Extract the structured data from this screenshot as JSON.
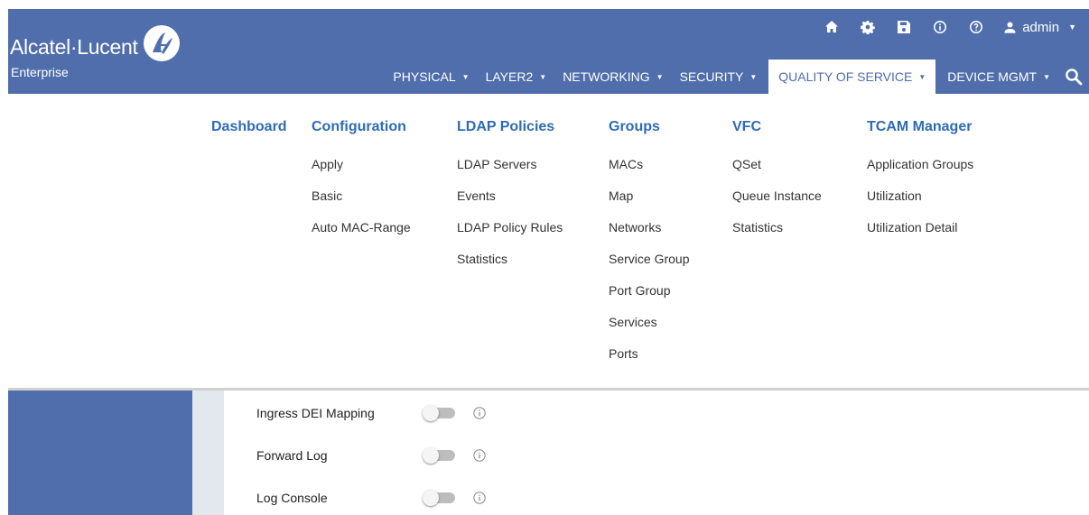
{
  "brand": {
    "name": "Alcatel·Lucent",
    "sub": "Enterprise",
    "colors": {
      "header": "#4f6eab",
      "link": "#2d6cb5",
      "toggle_off": "#bdbdbd",
      "gutter": "#e3e8ef"
    }
  },
  "topbar": {
    "icons": [
      "home-icon",
      "gear-icon",
      "save-icon",
      "info-icon",
      "help-icon"
    ],
    "user": "admin"
  },
  "nav": {
    "items": [
      {
        "label": "PHYSICAL"
      },
      {
        "label": "LAYER2"
      },
      {
        "label": "NETWORKING"
      },
      {
        "label": "SECURITY"
      },
      {
        "label": "QUALITY OF SERVICE",
        "active": true
      },
      {
        "label": "DEVICE MGMT"
      }
    ]
  },
  "menu": {
    "columns": [
      {
        "heading": "Dashboard",
        "items": []
      },
      {
        "heading": "Configuration",
        "items": [
          "Apply",
          "Basic",
          "Auto MAC-Range"
        ]
      },
      {
        "heading": "LDAP Policies",
        "items": [
          "LDAP Servers",
          "Events",
          "LDAP Policy Rules",
          "Statistics"
        ]
      },
      {
        "heading": "Groups",
        "items": [
          "MACs",
          "Map",
          "Networks",
          "Service Group",
          "Port Group",
          "Services",
          "Ports"
        ]
      },
      {
        "heading": "VFC",
        "items": [
          "QSet",
          "Queue Instance",
          "Statistics"
        ]
      },
      {
        "heading": "TCAM Manager",
        "items": [
          "Application Groups",
          "Utilization",
          "Utilization Detail"
        ]
      }
    ]
  },
  "settings": {
    "rows": [
      {
        "label": "Ingress DEI Mapping",
        "enabled": false
      },
      {
        "label": "Forward Log",
        "enabled": false
      },
      {
        "label": "Log Console",
        "enabled": false
      }
    ]
  }
}
